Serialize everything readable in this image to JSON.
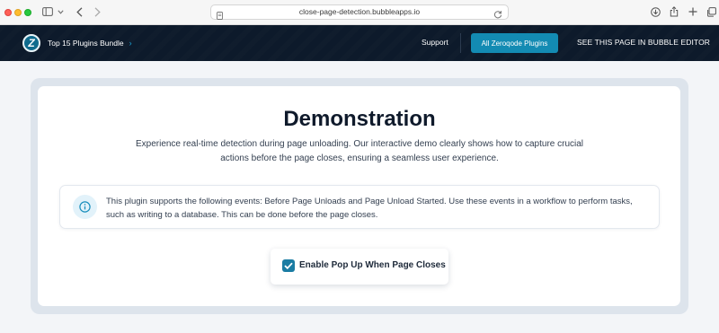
{
  "browser": {
    "url": "close-page-detection.bubbleapps.io",
    "icons": [
      "sidebar-icon",
      "chevron-down-icon",
      "back-icon",
      "forward-icon",
      "page-icon",
      "reload-icon",
      "download-icon",
      "share-icon",
      "new-tab-icon",
      "tabs-icon"
    ]
  },
  "header": {
    "logo_letter": "Z",
    "bundle_label": "Top 15 Plugins Bundle",
    "bundle_chevron": "›",
    "support_label": "Support",
    "all_plugins_label": "All Zeroqode Plugins",
    "editor_label": "SEE THIS PAGE IN BUBBLE EDITOR"
  },
  "main": {
    "title": "Demonstration",
    "subtitle": "Experience real-time detection during page unloading. Our interactive demo clearly shows how to capture crucial actions before the page closes, ensuring a seamless user experience.",
    "info_text": "This plugin supports the following events: Before Page Unloads and Page Unload Started. Use these events in a workflow to perform tasks, such as writing to a database. This can be done before the page closes.",
    "checkbox_label": "Enable Pop Up When Page Closes",
    "checkbox_checked": true
  },
  "colors": {
    "nav_background": "#0d1a2b",
    "accent": "#138bb3",
    "checkbox": "#1a7ca3",
    "page_background": "#f3f5f8"
  }
}
